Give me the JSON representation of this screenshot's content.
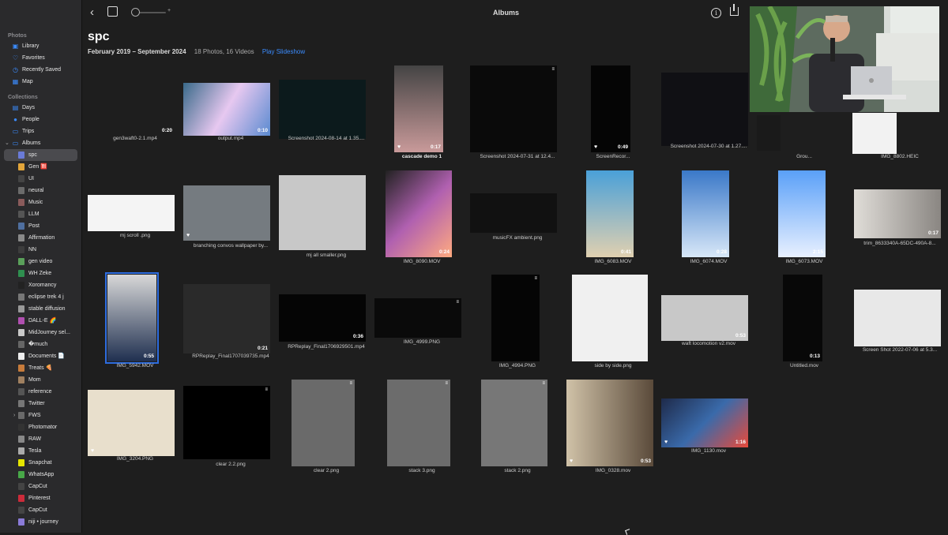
{
  "toolbar": {
    "title": "Albums",
    "zoom_plus": "+",
    "back_glyph": "‹"
  },
  "album": {
    "title": "spc",
    "date_range": "February 2019 – September 2024",
    "counts": "18 Photos, 16 Videos",
    "play": "Play Slideshow"
  },
  "sidebar": {
    "sections": [
      {
        "label": "Photos",
        "items": [
          {
            "label": "Library",
            "icon": "photo-library-icon"
          },
          {
            "label": "Favorites",
            "icon": "heart-icon"
          },
          {
            "label": "Recently Saved",
            "icon": "clock-icon"
          },
          {
            "label": "Map",
            "icon": "map-icon"
          }
        ]
      },
      {
        "label": "Collections",
        "items": [
          {
            "label": "Days",
            "icon": "calendar-icon"
          },
          {
            "label": "People",
            "icon": "person-icon"
          },
          {
            "label": "Trips",
            "icon": "suitcase-icon"
          },
          {
            "label": "Albums",
            "icon": "folder-icon"
          }
        ]
      }
    ],
    "albums": [
      {
        "label": "spc",
        "selected": true
      },
      {
        "label": "Gen 🈹"
      },
      {
        "label": "UI"
      },
      {
        "label": "neural"
      },
      {
        "label": "Music"
      },
      {
        "label": "LLM"
      },
      {
        "label": "Post"
      },
      {
        "label": "Affirmation"
      },
      {
        "label": "NN"
      },
      {
        "label": "gen video"
      },
      {
        "label": "WH Zeke"
      },
      {
        "label": "Xoromancy"
      },
      {
        "label": "eclipse trek 4 j"
      },
      {
        "label": "stable diffusion"
      },
      {
        "label": "DALL-E 🌈"
      },
      {
        "label": "MidJourney sel..."
      },
      {
        "label": "�much"
      },
      {
        "label": "Documents 📄"
      },
      {
        "label": "Treats 🍕"
      },
      {
        "label": "Mom"
      },
      {
        "label": "reference"
      },
      {
        "label": "Twitter"
      },
      {
        "label": "FWS",
        "folder": true
      },
      {
        "label": "Photomator"
      },
      {
        "label": "RAW"
      },
      {
        "label": "Tesla"
      },
      {
        "label": "Snapchat"
      },
      {
        "label": "WhatsApp"
      },
      {
        "label": "CapCut"
      },
      {
        "label": "Pinterest"
      },
      {
        "label": "CapCut"
      },
      {
        "label": "niji • journey"
      }
    ]
  },
  "grid": {
    "items": [
      {
        "caption": "gen3waft0-2.1.mp4",
        "duration": "0:20"
      },
      {
        "caption": "output.mp4",
        "duration": "0:10"
      },
      {
        "caption": "Screenshot 2024-08-14 at 1.35...."
      },
      {
        "caption": "cascade demo 1",
        "duration": "0:17",
        "bold": true,
        "heart": true
      },
      {
        "caption": "Screenshot 2024-07-31 at 12.4..."
      },
      {
        "caption": "ScreenRecor...",
        "duration": "0:49",
        "heart": true
      },
      {
        "caption": "Screenshot 2024-07-30 at 1.27...."
      },
      {
        "caption": "Grou..."
      },
      {
        "caption": "IMG_8802.HEIC"
      },
      {
        "caption": "mj scroll .png"
      },
      {
        "caption": "branching convos wallpaper by...",
        "heart": true
      },
      {
        "caption": "mj all smaller.png"
      },
      {
        "caption": "IMG_8090.MOV",
        "duration": "0:24"
      },
      {
        "caption": "musicFX ambient.png"
      },
      {
        "caption": "IMG_6083.MOV",
        "duration": "0:41"
      },
      {
        "caption": "IMG_6074.MOV",
        "duration": "0:28"
      },
      {
        "caption": "IMG_6073.MOV",
        "duration": "2:15"
      },
      {
        "caption": "trim_8633340A-65DC-490A-8...",
        "duration": "0:17"
      },
      {
        "caption": "IMG_5942.MOV",
        "duration": "0:55"
      },
      {
        "caption": "RPReplay_Final1707039735.mp4",
        "duration": "0:21"
      },
      {
        "caption": "RPReplay_Final1706929501.mp4",
        "duration": "0:36"
      },
      {
        "caption": "IMG_4999.PNG"
      },
      {
        "caption": "IMG_4994.PNG"
      },
      {
        "caption": "side by side.png"
      },
      {
        "caption": "waft locomotion v2.mov",
        "duration": "0:53"
      },
      {
        "caption": "Untitled.mov",
        "duration": "0:13"
      },
      {
        "caption": "Screen Shot 2022-07-06 at 5.3..."
      },
      {
        "caption": "IMG_3204.PNG",
        "heart": true
      },
      {
        "caption": "clear 2.2.png"
      },
      {
        "caption": "clear 2.png"
      },
      {
        "caption": "stack 3.png"
      },
      {
        "caption": "stack 2.png"
      },
      {
        "caption": "IMG_0328.mov",
        "duration": "0:53",
        "heart": true
      },
      {
        "caption": "IMG_1130.mov",
        "duration": "1:16",
        "heart": true
      }
    ]
  },
  "colors": {
    "accent": "#3b8cff",
    "selection": "#2d6cdf",
    "background": "#1e1e1e",
    "sidebar": "#2a2a2c"
  }
}
